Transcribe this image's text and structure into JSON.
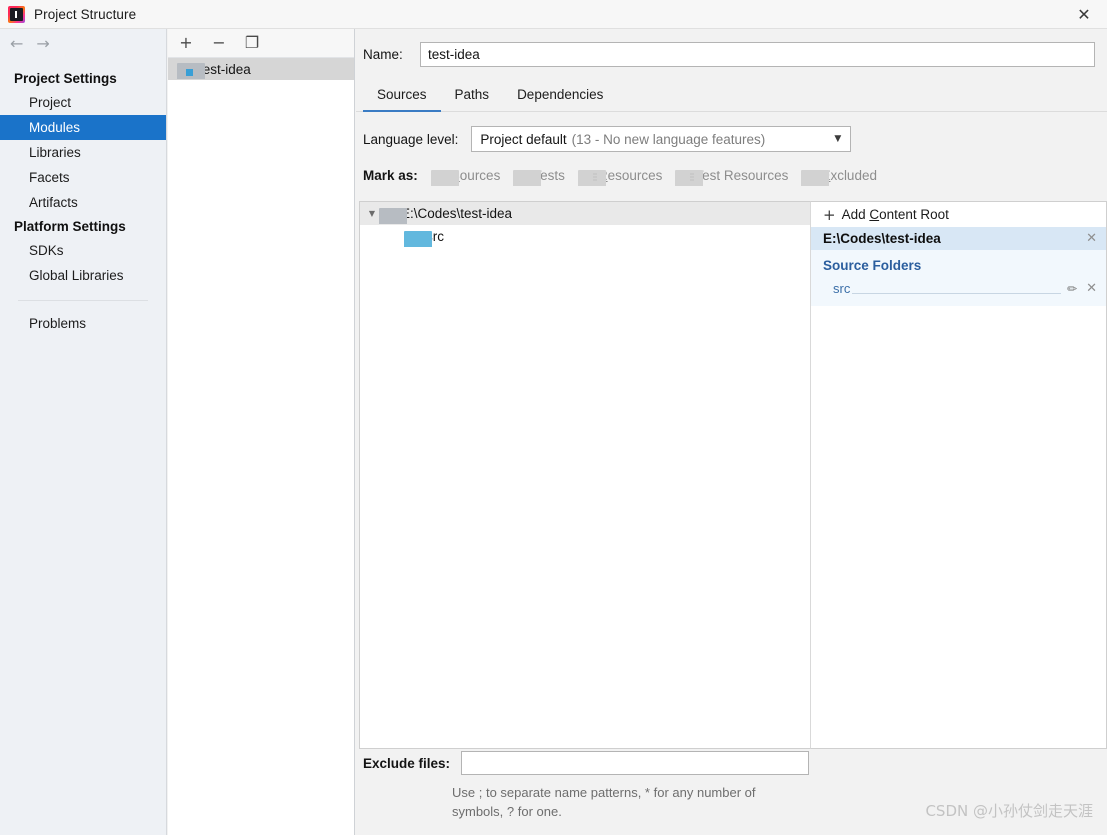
{
  "window": {
    "title": "Project Structure",
    "logo_icon": "intellij-idea-logo",
    "close_icon": "✕"
  },
  "nav": {
    "back_icon": "←",
    "forward_icon": "→"
  },
  "sidebar": {
    "groups": [
      {
        "label": "Project Settings",
        "items": [
          {
            "label": "Project",
            "selected": false
          },
          {
            "label": "Modules",
            "selected": true
          },
          {
            "label": "Libraries",
            "selected": false
          },
          {
            "label": "Facets",
            "selected": false
          },
          {
            "label": "Artifacts",
            "selected": false
          }
        ]
      },
      {
        "label": "Platform Settings",
        "items": [
          {
            "label": "SDKs",
            "selected": false
          },
          {
            "label": "Global Libraries",
            "selected": false
          }
        ]
      }
    ],
    "problems_label": "Problems"
  },
  "module_panel": {
    "toolbar": {
      "add_icon": "+",
      "remove_icon": "−",
      "copy_icon": "❐"
    },
    "modules": [
      {
        "label": "test-idea",
        "selected": true
      }
    ]
  },
  "main": {
    "name_label": "Name:",
    "name_value": "test-idea",
    "tabs": [
      {
        "label": "Sources",
        "active": true
      },
      {
        "label": "Paths",
        "active": false
      },
      {
        "label": "Dependencies",
        "active": false
      }
    ],
    "language_level": {
      "label": "Language level:",
      "value_primary": "Project default",
      "value_secondary": "(13 - No new language features)",
      "arrow_icon": "▼"
    },
    "mark_as": {
      "label": "Mark as:",
      "options": [
        {
          "mnemonic": "S",
          "rest": "ources",
          "icon": "folder-sources-icon"
        },
        {
          "mnemonic": "T",
          "rest": "ests",
          "icon": "folder-tests-icon"
        },
        {
          "mnemonic": "R",
          "rest": "esources",
          "icon": "folder-resources-icon"
        },
        {
          "mnemonic": "T",
          "rest": "est Resources",
          "icon": "folder-test-resources-icon"
        },
        {
          "mnemonic": "E",
          "rest": "xcluded",
          "icon": "folder-excluded-icon"
        }
      ]
    },
    "tree": {
      "expand_icon": "▼",
      "root": {
        "label": "E:\\Codes\\test-idea",
        "icon": "folder-gray-icon"
      },
      "children": [
        {
          "label": "src",
          "icon": "folder-blue-icon"
        }
      ]
    },
    "content_roots": {
      "add_label_mnemonic": "C",
      "add_label_before": "Add ",
      "add_label_after": "ontent Root",
      "add_icon": "+",
      "root_path": "E:\\Codes\\test-idea",
      "root_close_icon": "✕",
      "source_folders_title": "Source Folders",
      "source_folders": [
        {
          "name": "src",
          "edit_icon": "✏",
          "remove_icon": "✕"
        }
      ]
    },
    "exclude": {
      "label": "Exclude files:",
      "value": "",
      "placeholder": "",
      "hint": "Use ; to separate name patterns, * for any number of symbols, ? for one."
    }
  },
  "watermark": {
    "text": "CSDN @小孙仗剑走天涯"
  },
  "colors": {
    "selection_blue": "#1a73c9",
    "tab_underline": "#3a7cc4",
    "source_folder_blue": "#2b5e9e",
    "root_row_bg": "#d8e7f5"
  }
}
